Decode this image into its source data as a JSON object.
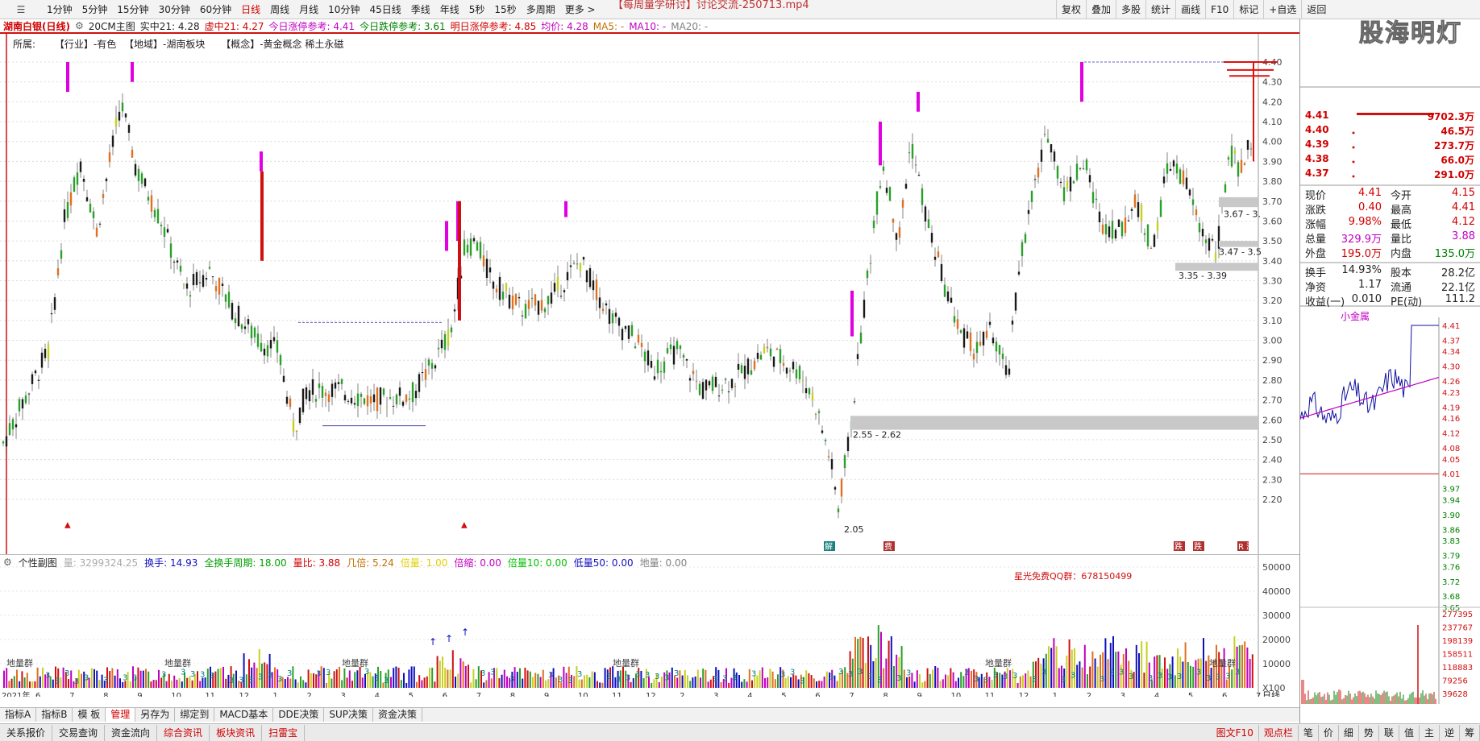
{
  "window": {
    "video_title": "【每周量学研讨】讨论交流-250713.mp4",
    "watermark": "股海明灯"
  },
  "toolbar": {
    "periods": [
      "1分钟",
      "5分钟",
      "15分钟",
      "30分钟",
      "60分钟",
      "日线",
      "周线",
      "月线",
      "10分钟",
      "45日线",
      "季线",
      "年线",
      "5秒",
      "15秒",
      "多周期",
      "更多 >"
    ],
    "active_period": "日线",
    "right_tools": [
      "复权",
      "叠加",
      "多股",
      "统计",
      "画线",
      "F10",
      "标记",
      "+自选",
      "返回"
    ]
  },
  "quote_bar": {
    "stock": "湖南白银(日线)",
    "indicator": "20CM主图",
    "items": [
      {
        "label": "实中21: 4.28",
        "color": "#222222"
      },
      {
        "label": "虚中21: 4.27",
        "color": "#d00000"
      },
      {
        "label": "今日涨停参考: 4.41",
        "color": "#c000c0"
      },
      {
        "label": "今日跌停参考: 3.61",
        "color": "#008000"
      },
      {
        "label": "明日涨停参考: 4.85",
        "color": "#d00000"
      },
      {
        "label": "均价: 4.28",
        "color": "#c000c0"
      },
      {
        "label": "MA5: -",
        "color": "#c07000"
      },
      {
        "label": "MA10: -",
        "color": "#c000c0"
      },
      {
        "label": "MA20: -",
        "color": "#808080"
      }
    ]
  },
  "sector_line": {
    "label": "所属:",
    "industry": "【行业】-有色",
    "region": "【地域】-湖南板块",
    "concept": "【概念】-黄金概念 稀土永磁"
  },
  "main_chart": {
    "y_ticks": [
      "4.40",
      "4.30",
      "4.20",
      "4.10",
      "4.00",
      "3.90",
      "3.80",
      "3.70",
      "3.60",
      "3.50",
      "3.40",
      "3.30",
      "3.20",
      "3.10",
      "3.00",
      "2.90",
      "2.80",
      "2.70",
      "2.60",
      "2.50",
      "2.40",
      "2.30",
      "2.20"
    ],
    "gap_labels": [
      "3.67 - 3.",
      "3.47 - 3.5",
      "3.35 - 3.39",
      "2.55 - 2.62"
    ],
    "low_label": "2.05",
    "markers": [
      "解",
      "费",
      "跌",
      "跌",
      "R 涨"
    ]
  },
  "sub_chart": {
    "title": "个性副图",
    "items": [
      {
        "label": "量: 3299324.25",
        "color": "#aaaaaa"
      },
      {
        "label": "换手: 14.93",
        "color": "#1010c0"
      },
      {
        "label": "全换手周期: 18.00",
        "color": "#00a000"
      },
      {
        "label": "量比: 3.88",
        "color": "#d00000"
      },
      {
        "label": "几倍: 5.24",
        "color": "#c07000"
      },
      {
        "label": "倍量: 1.00",
        "color": "#e0d000"
      },
      {
        "label": "倍缩: 0.00",
        "color": "#c000c0"
      },
      {
        "label": "倍量10: 0.00",
        "color": "#00c000"
      },
      {
        "label": "低量50: 0.00",
        "color": "#1010c0"
      },
      {
        "label": "地量: 0.00",
        "color": "#808080"
      }
    ],
    "qq_text": "星光免费QQ群：678150499",
    "y_ticks": [
      "50000",
      "40000",
      "30000",
      "20000",
      "10000",
      "X100"
    ],
    "x_months": [
      "2021年",
      "6",
      "7",
      "8",
      "9",
      "10",
      "11",
      "12",
      "1",
      "2",
      "3",
      "4",
      "5",
      "6",
      "7",
      "8",
      "9",
      "10",
      "11",
      "12",
      "2",
      "3",
      "4",
      "5",
      "6",
      "7",
      "8",
      "9",
      "10",
      "11",
      "12",
      "1",
      "2",
      "3",
      "4",
      "5",
      "6",
      "7"
    ],
    "period_label": "日线",
    "dl_labels": [
      "地量群",
      "地量群",
      "地量群",
      "地量群",
      "地量群",
      "地量群"
    ]
  },
  "indicator_tabs": [
    "指标A",
    "指标B",
    "模 板",
    "管理",
    "另存为",
    "绑定到",
    "MACD基本",
    "DDE决策",
    "SUP决策",
    "资金决策"
  ],
  "active_indicator_tab": "管理",
  "bottom_tabs": [
    "关系报价",
    "交易查询",
    "资金流向",
    "综合资讯",
    "板块资讯",
    "扫雷宝"
  ],
  "bottom_right_tabs": [
    "图文F10",
    "观点栏",
    "笔",
    "价",
    "细",
    "势",
    "联",
    "值",
    "主",
    "逆",
    "筹"
  ],
  "order_book": [
    {
      "price": "4.41",
      "vol": "9702.3万"
    },
    {
      "price": "4.40",
      "vol": "46.5万"
    },
    {
      "price": "4.39",
      "vol": "273.7万"
    },
    {
      "price": "4.38",
      "vol": "66.0万"
    },
    {
      "price": "4.37",
      "vol": "291.0万"
    }
  ],
  "stats": [
    {
      "l1": "现价",
      "v1": "4.41",
      "c1": "#d00000",
      "l2": "今开",
      "v2": "4.15",
      "c2": "#d00000"
    },
    {
      "l1": "涨跌",
      "v1": "0.40",
      "c1": "#d00000",
      "l2": "最高",
      "v2": "4.41",
      "c2": "#d00000"
    },
    {
      "l1": "涨幅",
      "v1": "9.98%",
      "c1": "#d00000",
      "l2": "最低",
      "v2": "4.12",
      "c2": "#d00000"
    },
    {
      "l1": "总量",
      "v1": "329.9万",
      "c1": "#c000c0",
      "l2": "量比",
      "v2": "3.88",
      "c2": "#c000c0"
    },
    {
      "l1": "外盘",
      "v1": "195.0万",
      "c1": "#d00000",
      "l2": "内盘",
      "v2": "135.0万",
      "c2": "#008000"
    },
    {
      "l1": "换手",
      "v1": "14.93%",
      "c1": "#222222",
      "l2": "股本",
      "v2": "28.2亿",
      "c2": "#222222"
    },
    {
      "l1": "净资",
      "v1": "1.17",
      "c1": "#222222",
      "l2": "流通",
      "v2": "22.1亿",
      "c2": "#222222"
    },
    {
      "l1": "收益(一)",
      "v1": "0.010",
      "c1": "#222222",
      "l2": "PE(动)",
      "v2": "111.2",
      "c2": "#222222"
    }
  ],
  "intraday": {
    "tag": "小金属",
    "price_ticks": [
      "4.41",
      "4.37",
      "4.34",
      "4.30",
      "4.26",
      "4.23",
      "4.19",
      "4.16",
      "4.12",
      "4.08",
      "4.05",
      "4.01",
      "3.97",
      "3.94",
      "3.90",
      "3.86",
      "3.83",
      "3.79",
      "3.76",
      "3.72",
      "3.68",
      "3.65"
    ],
    "vol_ticks": [
      "277395",
      "237767",
      "198139",
      "158511",
      "118883",
      "79256",
      "39628"
    ]
  },
  "colors": {
    "up": "#d00000",
    "down": "#008000",
    "accent": "#d01010"
  }
}
